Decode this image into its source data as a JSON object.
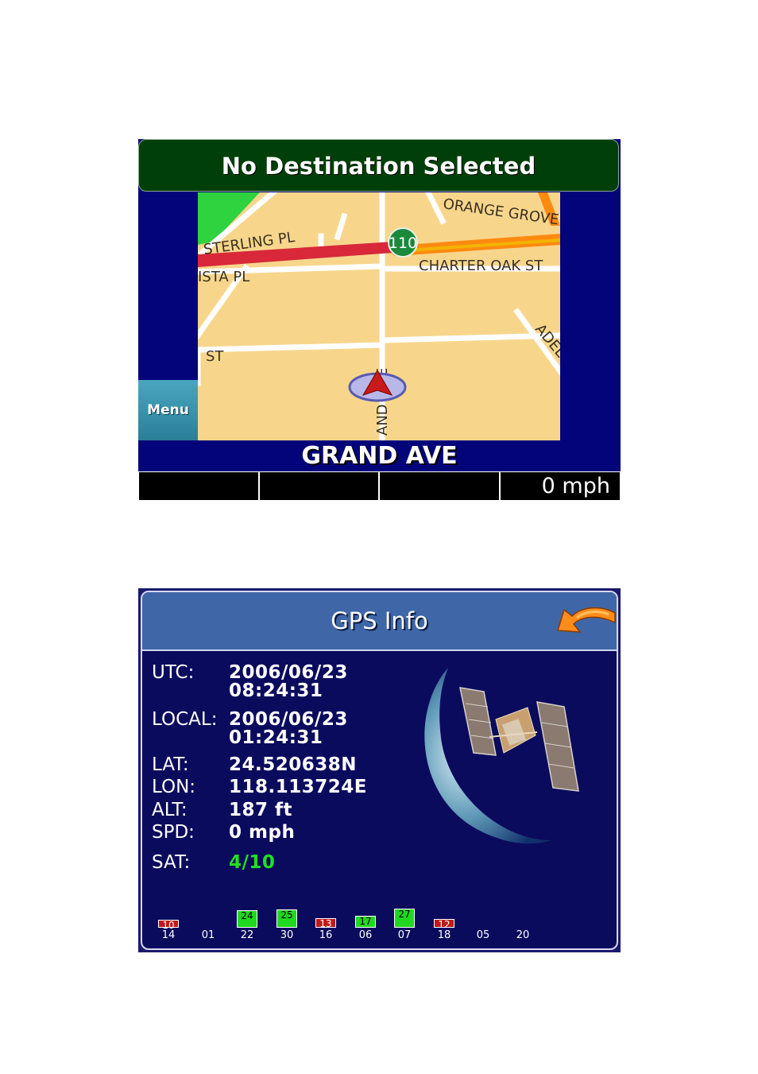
{
  "nav": {
    "destination_banner": "No Destination Selected",
    "menu_label": "Menu",
    "current_street": "GRAND AVE",
    "speed": "0 mph",
    "map_labels": {
      "orange_grove": "ORANGE GROVE",
      "highway_shield": "110",
      "sterling_pl": "STERLING PL",
      "charter_oak": "CHARTER OAK ST",
      "vista_pl": "ISTA PL",
      "st": "ST",
      "adel": "ADEL",
      "grand_vertical": "AND",
      "grand_vertical_e": "E"
    }
  },
  "gps": {
    "title": "GPS Info",
    "utc": {
      "label": "UTC:",
      "date": "2006/06/23",
      "time": "08:24:31"
    },
    "local": {
      "label": "LOCAL:",
      "date": "2006/06/23",
      "time": "01:24:31"
    },
    "lat": {
      "label": "LAT:",
      "value": "24.520638N"
    },
    "lon": {
      "label": "LON:",
      "value": "118.113724E"
    },
    "alt": {
      "label": "ALT:",
      "value": "187 ft"
    },
    "spd": {
      "label": "SPD:",
      "value": "0 mph"
    },
    "sat": {
      "label": "SAT:",
      "value": "4/10"
    },
    "colors": {
      "used": "#1fd81f",
      "unused": "#c01818"
    },
    "satellites": [
      {
        "prn": "14",
        "snr": "10",
        "status": "unused"
      },
      {
        "prn": "01",
        "snr": "",
        "status": "none"
      },
      {
        "prn": "22",
        "snr": "24",
        "status": "used"
      },
      {
        "prn": "30",
        "snr": "25",
        "status": "used"
      },
      {
        "prn": "16",
        "snr": "13",
        "status": "unused"
      },
      {
        "prn": "06",
        "snr": "17",
        "status": "used"
      },
      {
        "prn": "07",
        "snr": "27",
        "status": "used"
      },
      {
        "prn": "18",
        "snr": "12",
        "status": "unused"
      },
      {
        "prn": "05",
        "snr": "",
        "status": "none"
      },
      {
        "prn": "20",
        "snr": "",
        "status": "none"
      }
    ]
  }
}
